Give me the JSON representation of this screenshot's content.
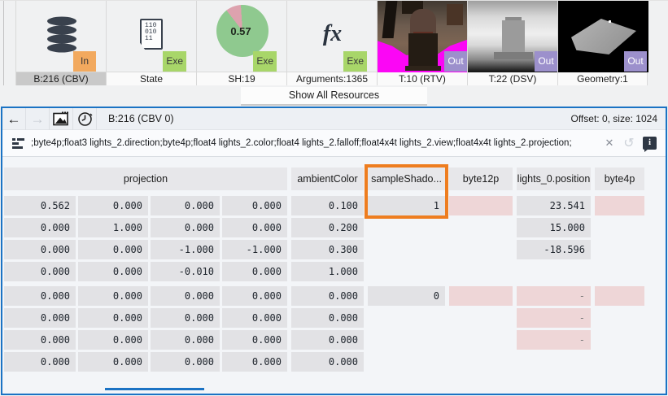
{
  "resource_strip": {
    "tiles": [
      {
        "label": "B:216 (CBV)",
        "badge": "In",
        "selected": true,
        "icon": "database-icon"
      },
      {
        "label": "State",
        "badge": "Exe",
        "icon": "state-binary-icon",
        "icon_lines": [
          "110",
          "010",
          "11"
        ]
      },
      {
        "label": "SH:19",
        "badge": "Exe",
        "icon": "pie-chart-icon",
        "pie_value": "0.57"
      },
      {
        "label": "Arguments:1365",
        "badge": "Exe",
        "icon": "fx-icon",
        "fx_label": "fx"
      },
      {
        "label": "T:10 (RTV)",
        "badge": "Out",
        "icon": "rtv-thumbnail"
      },
      {
        "label": "T:22 (DSV)",
        "badge": "Out",
        "icon": "dsv-thumbnail"
      },
      {
        "label": "Geometry:1",
        "badge": "Out",
        "icon": "geometry-thumbnail"
      }
    ],
    "show_all_label": "Show All Resources"
  },
  "panel": {
    "title": "B:216 (CBV 0)",
    "offset_info": "Offset: 0, size: 1024",
    "format_string": ";byte4p;float3 lights_2.direction;byte4p;float4 lights_2.color;float4 lights_2.falloff;float4x4t lights_2.view;float4x4t lights_2.projection;",
    "icons": {
      "back": "←",
      "forward": "→",
      "clear": "✕",
      "undo": "↺",
      "info": "i"
    }
  },
  "table": {
    "headers": [
      "projection",
      "ambientColor",
      "sampleShado...",
      "byte12p",
      "lights_0.position",
      "byte4p"
    ],
    "highlighted_column": "sampleShado...",
    "rows": [
      {
        "gap": false,
        "cells": [
          {
            "t": "n",
            "v": "0.562"
          },
          {
            "t": "n",
            "v": "0.000"
          },
          {
            "t": "n",
            "v": "0.000"
          },
          {
            "t": "n",
            "v": "0.000"
          },
          {
            "t": "n",
            "v": "0.100"
          },
          {
            "t": "n",
            "v": "1",
            "hl": true
          },
          {
            "t": "p"
          },
          {
            "t": "n",
            "v": "23.541"
          },
          {
            "t": "p"
          }
        ]
      },
      {
        "gap": false,
        "cells": [
          {
            "t": "n",
            "v": "0.000"
          },
          {
            "t": "n",
            "v": "1.000"
          },
          {
            "t": "n",
            "v": "0.000"
          },
          {
            "t": "n",
            "v": "0.000"
          },
          {
            "t": "n",
            "v": "0.200"
          },
          {
            "t": "b"
          },
          {
            "t": "b"
          },
          {
            "t": "n",
            "v": "15.000"
          },
          {
            "t": "b"
          }
        ]
      },
      {
        "gap": false,
        "cells": [
          {
            "t": "n",
            "v": "0.000"
          },
          {
            "t": "n",
            "v": "0.000"
          },
          {
            "t": "n",
            "v": "-1.000"
          },
          {
            "t": "n",
            "v": "-1.000"
          },
          {
            "t": "n",
            "v": "0.300"
          },
          {
            "t": "b"
          },
          {
            "t": "b"
          },
          {
            "t": "n",
            "v": "-18.596"
          },
          {
            "t": "b"
          }
        ]
      },
      {
        "gap": false,
        "cells": [
          {
            "t": "n",
            "v": "0.000"
          },
          {
            "t": "n",
            "v": "0.000"
          },
          {
            "t": "n",
            "v": "-0.010"
          },
          {
            "t": "n",
            "v": "0.000"
          },
          {
            "t": "n",
            "v": "1.000"
          },
          {
            "t": "b"
          },
          {
            "t": "b"
          },
          {
            "t": "b"
          },
          {
            "t": "b"
          }
        ]
      },
      {
        "gap": true,
        "cells": [
          {
            "t": "n",
            "v": "0.000"
          },
          {
            "t": "n",
            "v": "0.000"
          },
          {
            "t": "n",
            "v": "0.000"
          },
          {
            "t": "n",
            "v": "0.000"
          },
          {
            "t": "n",
            "v": "0.000"
          },
          {
            "t": "n",
            "v": "0"
          },
          {
            "t": "p"
          },
          {
            "t": "pd",
            "v": "-"
          },
          {
            "t": "p"
          }
        ]
      },
      {
        "gap": false,
        "cells": [
          {
            "t": "n",
            "v": "0.000"
          },
          {
            "t": "n",
            "v": "0.000"
          },
          {
            "t": "n",
            "v": "0.000"
          },
          {
            "t": "n",
            "v": "0.000"
          },
          {
            "t": "n",
            "v": "0.000"
          },
          {
            "t": "b"
          },
          {
            "t": "b"
          },
          {
            "t": "pd",
            "v": "-"
          },
          {
            "t": "b"
          }
        ]
      },
      {
        "gap": false,
        "cells": [
          {
            "t": "n",
            "v": "0.000"
          },
          {
            "t": "n",
            "v": "0.000"
          },
          {
            "t": "n",
            "v": "0.000"
          },
          {
            "t": "n",
            "v": "0.000"
          },
          {
            "t": "n",
            "v": "0.000"
          },
          {
            "t": "b"
          },
          {
            "t": "b"
          },
          {
            "t": "pd",
            "v": "-"
          },
          {
            "t": "b"
          }
        ]
      },
      {
        "gap": false,
        "cells": [
          {
            "t": "n",
            "v": "0.000"
          },
          {
            "t": "n",
            "v": "0.000"
          },
          {
            "t": "n",
            "v": "0.000"
          },
          {
            "t": "n",
            "v": "0.000"
          },
          {
            "t": "n",
            "v": "0.000"
          },
          {
            "t": "b"
          },
          {
            "t": "b"
          },
          {
            "t": "b"
          },
          {
            "t": "b"
          }
        ]
      }
    ]
  },
  "colors": {
    "accent_blue": "#1b73c4",
    "highlight_orange": "#ee7d1f",
    "cell_gray": "#e2e2e5",
    "cell_pink": "#eed6d7",
    "badge_in": "#f2a95e",
    "badge_exe": "#a8d669",
    "badge_out": "#9c90cc"
  }
}
